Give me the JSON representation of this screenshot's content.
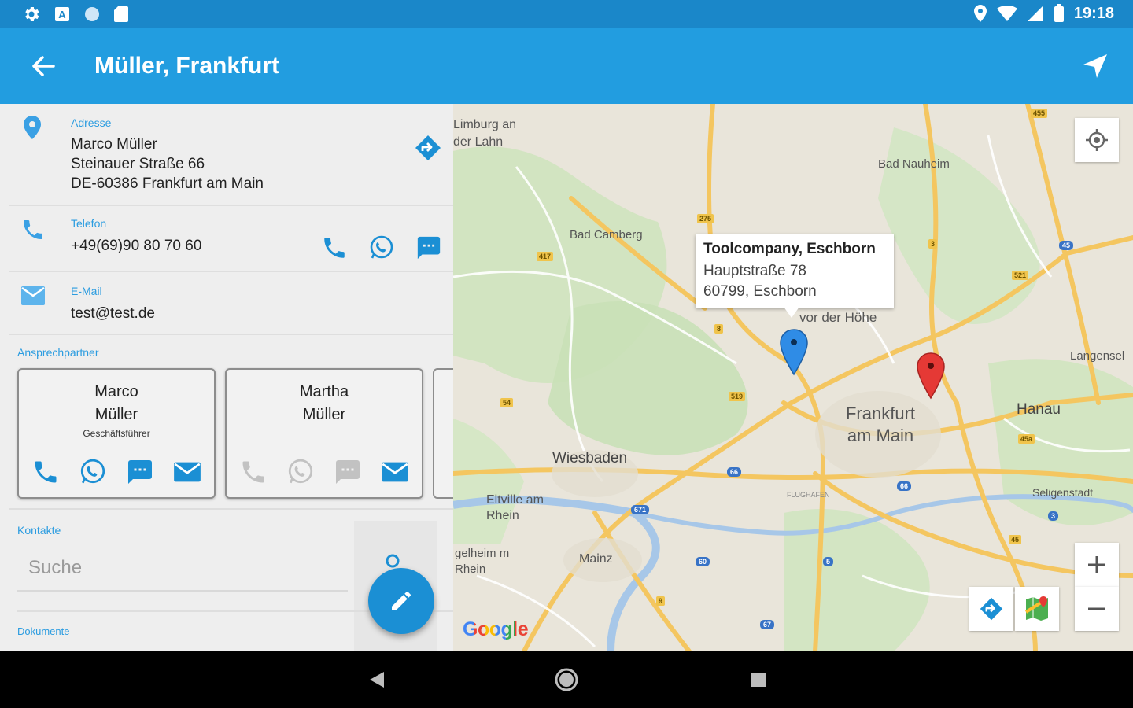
{
  "status_bar": {
    "time": "19:18"
  },
  "app_bar": {
    "title": "Müller, Frankfurt"
  },
  "address": {
    "label": "Adresse",
    "lines": [
      "Marco Müller",
      "Steinauer Straße 66",
      "DE-60386 Frankfurt am Main"
    ]
  },
  "phone": {
    "label": "Telefon",
    "value": "+49(69)90 80 70 60"
  },
  "email": {
    "label": "E-Mail",
    "value": "test@test.de"
  },
  "contacts_section": {
    "label": "Ansprechpartner",
    "cards": [
      {
        "first": "Marco",
        "last": "Müller",
        "role": "Geschäftsführer"
      },
      {
        "first": "Martha",
        "last": "Müller",
        "role": ""
      }
    ]
  },
  "kontakte": {
    "label": "Kontakte",
    "search_placeholder": "Suche"
  },
  "dokumente": {
    "label": "Dokumente"
  },
  "map": {
    "places": {
      "limburg": "Limburg an der Lahn",
      "bad_nauheim": "Bad Nauheim",
      "bad_camberg": "Bad Camberg",
      "vor_der_hoehe": "vor der Höhe",
      "langensel": "Langensel",
      "frankfurt": "Frankfurt am Main",
      "hanau": "Hanau",
      "wiesbaden": "Wiesbaden",
      "eltville": "Eltville am Rhein",
      "flughafen": "FLUGHAFEN",
      "seligenstadt": "Seligenstadt",
      "ingelheim": "gelheim m Rhein",
      "mainz": "Mainz"
    },
    "road_labels": [
      "455",
      "275",
      "3",
      "45",
      "417",
      "521",
      "8",
      "54",
      "519",
      "45a",
      "66",
      "66",
      "671",
      "60",
      "5",
      "67",
      "9",
      "3",
      "45"
    ],
    "info_window": {
      "title": "Toolcompany, Eschborn",
      "line1": "Hauptstraße 78",
      "line2": "60799, Eschborn"
    },
    "attribution": "Google",
    "colors": {
      "marker_blue": "#2f8ce6",
      "marker_red": "#e53935"
    }
  },
  "colors": {
    "status_bar": "#1a87c9",
    "app_bar": "#229de0",
    "accent": "#2b9ce0",
    "fab": "#1b8fd4"
  }
}
